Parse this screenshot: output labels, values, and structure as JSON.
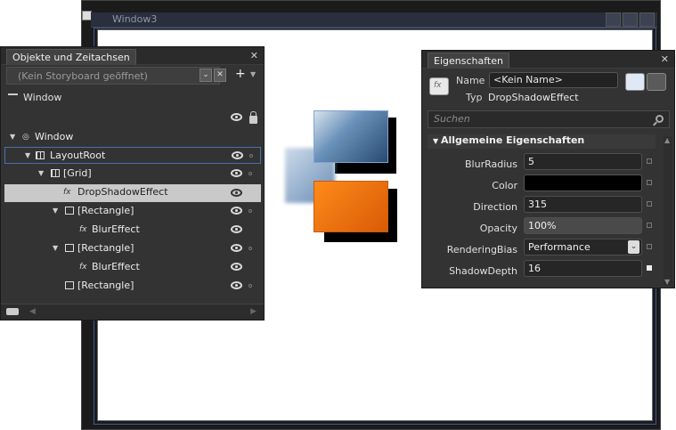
{
  "designer_window": {
    "title": "Window3"
  },
  "objects_panel": {
    "title": "Objekte und Zeitachsen",
    "storyboard_placeholder": "(Kein Storyboard geöffnet)",
    "scope_label": "Window",
    "tree": [
      {
        "label": "Window",
        "expanded": true
      },
      {
        "label": "LayoutRoot",
        "expanded": true
      },
      {
        "label": "[Grid]",
        "expanded": true
      },
      {
        "label": "DropShadowEffect",
        "selected": true
      },
      {
        "label": "[Rectangle]",
        "expanded": true
      },
      {
        "label": "BlurEffect"
      },
      {
        "label": "[Rectangle]",
        "expanded": true
      },
      {
        "label": "BlurEffect"
      },
      {
        "label": "[Rectangle]"
      }
    ]
  },
  "properties_panel": {
    "title": "Eigenschaften",
    "name_label": "Name",
    "name_value": "<Kein Name>",
    "type_label": "Typ",
    "type_value": "DropShadowEffect",
    "search_placeholder": "Suchen",
    "category": "Allgemeine Eigenschaften",
    "properties": [
      {
        "label": "BlurRadius",
        "value": "5"
      },
      {
        "label": "Color",
        "value": "",
        "color": "#000000"
      },
      {
        "label": "Direction",
        "value": "315"
      },
      {
        "label": "Opacity",
        "value": "100%"
      },
      {
        "label": "RenderingBias",
        "value": "Performance"
      },
      {
        "label": "ShadowDepth",
        "value": "16"
      }
    ]
  }
}
